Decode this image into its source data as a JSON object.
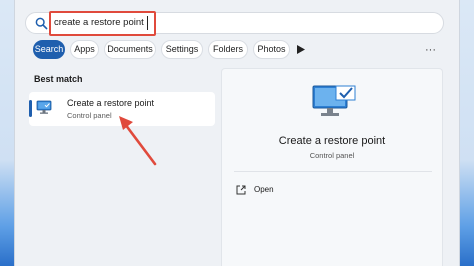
{
  "search": {
    "query": "create a restore point",
    "icon": "search-icon"
  },
  "filters": {
    "chips": [
      {
        "label": "Search",
        "active": true
      },
      {
        "label": "Apps",
        "active": false
      },
      {
        "label": "Documents",
        "active": false
      },
      {
        "label": "Settings",
        "active": false
      },
      {
        "label": "Folders",
        "active": false
      },
      {
        "label": "Photos",
        "active": false
      }
    ],
    "play_icon": "play-icon",
    "more_icon": "more-icon"
  },
  "results": {
    "section_label": "Best match",
    "items": [
      {
        "title": "Create a restore point",
        "subtitle": "Control panel",
        "icon": "monitor-checkmark-icon"
      }
    ]
  },
  "detail": {
    "title": "Create a restore point",
    "subtitle": "Control panel",
    "icon": "monitor-checkmark-icon",
    "actions": [
      {
        "label": "Open",
        "icon": "open-external-icon"
      }
    ]
  },
  "colors": {
    "accent": "#1f5fae",
    "highlight_box": "#e04a3c",
    "annotation_arrow": "#e04a3c"
  }
}
